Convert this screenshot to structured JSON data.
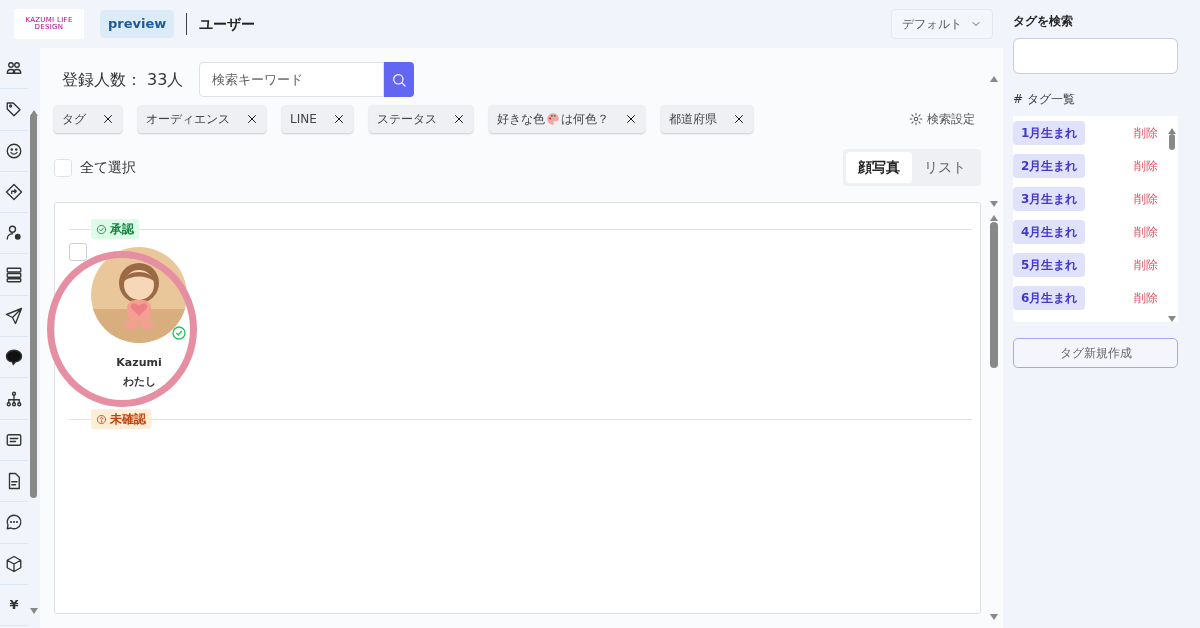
{
  "header": {
    "logo_text": "KAZUMI LIFE DESIGN",
    "badge": "preview",
    "title": "ユーザー",
    "view_dropdown": "デフォルト"
  },
  "sidebar": {
    "last_item": "¥"
  },
  "toolbar": {
    "count_label": "登録人数：",
    "count": "33人",
    "search": {
      "placeholder": "検索キーワード"
    }
  },
  "filters": [
    {
      "label": "タグ"
    },
    {
      "label": "オーディエンス"
    },
    {
      "label": "LINE"
    },
    {
      "label": "ステータス"
    },
    {
      "label": "好きな色",
      "label_end": "は何色？"
    },
    {
      "label": "都道府県"
    }
  ],
  "search_settings": "検索設定",
  "select_all": {
    "label": "全て選択",
    "checked": false
  },
  "view_tabs": [
    {
      "label": "顔写真",
      "selected": true
    },
    {
      "label": "リスト",
      "selected": false
    }
  ],
  "groups": [
    {
      "label": "承認",
      "kind": "approved",
      "users": [
        {
          "name": "Kazumi",
          "nickname": "わたし",
          "verified": true,
          "checked": false,
          "highlighted": true
        }
      ]
    },
    {
      "label": "未確認",
      "kind": "unconfirmed"
    }
  ],
  "tag_panel": {
    "search_label": "タグを検索",
    "list_heading": "# タグ一覧",
    "tags": [
      {
        "name": "1月生まれ",
        "action": "削除"
      },
      {
        "name": "2月生まれ",
        "action": "削除"
      },
      {
        "name": "3月生まれ",
        "action": "削除"
      },
      {
        "name": "4月生まれ",
        "action": "削除"
      },
      {
        "name": "5月生まれ",
        "action": "削除"
      },
      {
        "name": "6月生まれ",
        "action": "削除"
      }
    ],
    "create_button": "タグ新規作成"
  }
}
